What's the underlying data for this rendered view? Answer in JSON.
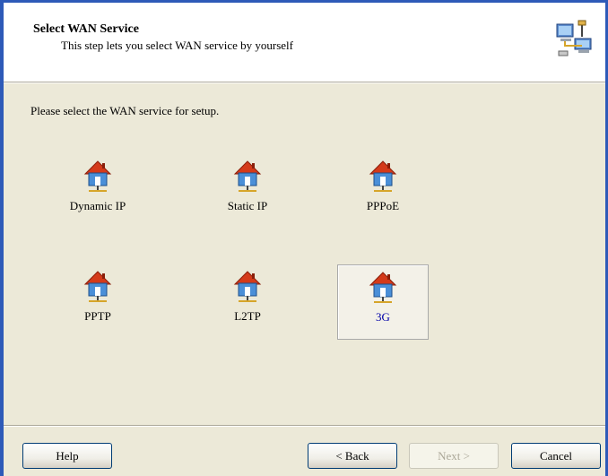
{
  "header": {
    "title": "Select WAN Service",
    "subtitle": "This step lets you select WAN service by yourself"
  },
  "prompt": "Please select the WAN service for setup.",
  "services": [
    {
      "label": "Dynamic IP",
      "selected": false
    },
    {
      "label": "Static IP",
      "selected": false
    },
    {
      "label": "PPPoE",
      "selected": false
    },
    {
      "label": "PPTP",
      "selected": false
    },
    {
      "label": "L2TP",
      "selected": false
    },
    {
      "label": "3G",
      "selected": true
    }
  ],
  "buttons": {
    "help": "Help",
    "back": "< Back",
    "next": "Next >",
    "cancel": "Cancel"
  },
  "colors": {
    "window_border": "#2e5ab8",
    "dialog_bg": "#ece9d8",
    "roof": "#d43a1a",
    "house_body": "#4a8fd8"
  }
}
